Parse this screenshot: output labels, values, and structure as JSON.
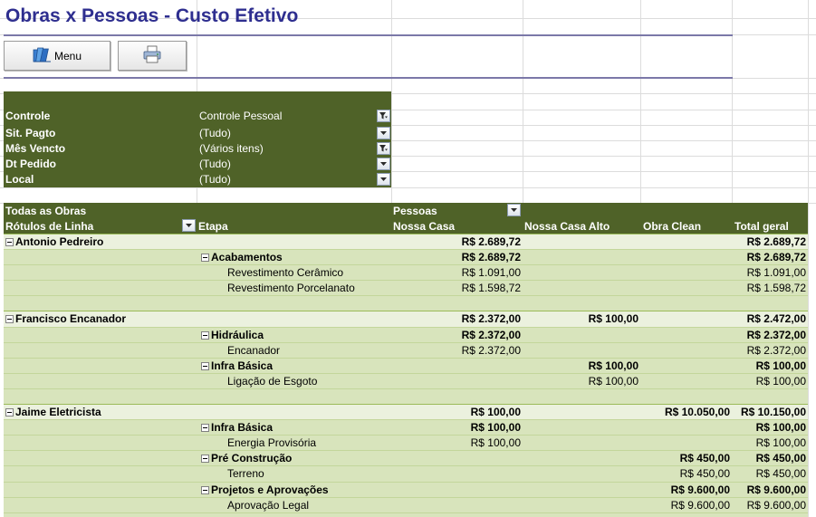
{
  "title": "Obras x Pessoas - Custo Efetivo",
  "toolbar": {
    "menu_label": "Menu"
  },
  "filters": [
    {
      "label": "Controle",
      "value": "Controle Pessoal",
      "filtered": true
    },
    {
      "label": "Sit. Pagto",
      "value": "(Tudo)",
      "filtered": false
    },
    {
      "label": "Mês Vencto",
      "value": "(Vários itens)",
      "filtered": true
    },
    {
      "label": "Dt Pedido",
      "value": "(Tudo)",
      "filtered": false
    },
    {
      "label": "Local",
      "value": "(Tudo)",
      "filtered": false
    }
  ],
  "pivot": {
    "report_filter": "Todas as Obras",
    "column_field": "Pessoas",
    "row_labels": "Rótulos de Linha",
    "row_field2": "Etapa",
    "columns": [
      "Nossa Casa",
      "Nossa Casa Alto",
      "Obra Clean",
      "Total geral"
    ],
    "rows": [
      {
        "level": 0,
        "label": "Antonio Pedreiro",
        "values": [
          "R$ 2.689,72",
          "",
          "",
          "R$ 2.689,72"
        ]
      },
      {
        "level": 1,
        "label": "Acabamentos",
        "values": [
          "R$ 2.689,72",
          "",
          "",
          "R$ 2.689,72"
        ]
      },
      {
        "level": 2,
        "label": "Revestimento Cerâmico",
        "values": [
          "R$ 1.091,00",
          "",
          "",
          "R$ 1.091,00"
        ]
      },
      {
        "level": 2,
        "label": "Revestimento Porcelanato",
        "values": [
          "R$ 1.598,72",
          "",
          "",
          "R$ 1.598,72"
        ]
      },
      {
        "level": -1,
        "label": "",
        "values": [
          "",
          "",
          "",
          ""
        ]
      },
      {
        "level": 0,
        "label": "Francisco Encanador",
        "values": [
          "R$ 2.372,00",
          "R$ 100,00",
          "",
          "R$ 2.472,00"
        ]
      },
      {
        "level": 1,
        "label": "Hidráulica",
        "values": [
          "R$ 2.372,00",
          "",
          "",
          "R$ 2.372,00"
        ]
      },
      {
        "level": 2,
        "label": "Encanador",
        "values": [
          "R$ 2.372,00",
          "",
          "",
          "R$ 2.372,00"
        ]
      },
      {
        "level": 1,
        "label": "Infra Básica",
        "values": [
          "",
          "R$ 100,00",
          "",
          "R$ 100,00"
        ]
      },
      {
        "level": 2,
        "label": "Ligação de Esgoto",
        "values": [
          "",
          "R$ 100,00",
          "",
          "R$ 100,00"
        ]
      },
      {
        "level": -1,
        "label": "",
        "values": [
          "",
          "",
          "",
          ""
        ]
      },
      {
        "level": 0,
        "label": "Jaime Eletricista",
        "values": [
          "R$ 100,00",
          "",
          "R$ 10.050,00",
          "R$ 10.150,00"
        ]
      },
      {
        "level": 1,
        "label": "Infra Básica",
        "values": [
          "R$ 100,00",
          "",
          "",
          "R$ 100,00"
        ]
      },
      {
        "level": 2,
        "label": "Energia Provisória",
        "values": [
          "R$ 100,00",
          "",
          "",
          "R$ 100,00"
        ]
      },
      {
        "level": 1,
        "label": "Pré Construção",
        "values": [
          "",
          "",
          "R$ 450,00",
          "R$ 450,00"
        ]
      },
      {
        "level": 2,
        "label": "Terreno",
        "values": [
          "",
          "",
          "R$ 450,00",
          "R$ 450,00"
        ]
      },
      {
        "level": 1,
        "label": "Projetos e Aprovações",
        "values": [
          "",
          "",
          "R$ 9.600,00",
          "R$ 9.600,00"
        ]
      },
      {
        "level": 2,
        "label": "Aprovação Legal",
        "values": [
          "",
          "",
          "R$ 9.600,00",
          "R$ 9.600,00"
        ]
      },
      {
        "level": -1,
        "label": "",
        "values": [
          "",
          "",
          "",
          ""
        ]
      }
    ]
  },
  "colors": {
    "title": "#2e2e8f",
    "header_bg": "#4f6228",
    "row_light": "#ebf1de",
    "row_green": "#d8e4bc"
  },
  "icons": {
    "menu": "books-icon",
    "print": "printer-icon",
    "filter": "funnel-icon",
    "dropdown": "chevron-down-icon",
    "collapse": "minus-box-icon"
  }
}
